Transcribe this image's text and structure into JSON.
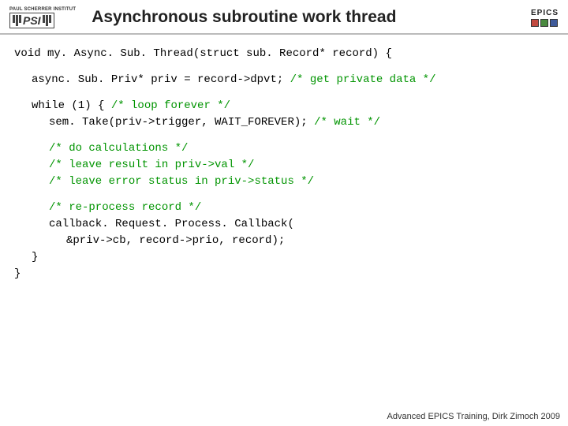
{
  "header": {
    "psi_top": "PAUL SCHERRER INSTITUT",
    "psi_text": "PSI",
    "title": "Asynchronous subroutine work thread",
    "epics_label": "EPICS"
  },
  "code": {
    "l01a": "void my. Async. Sub. Thread(struct sub. Record* record) {",
    "l02a": "async. Sub. Priv* priv = record->dpvt; ",
    "l02c": "/* get private data */",
    "l03a": "while (1) { ",
    "l03c": "/* loop forever */",
    "l04a": "sem. Take(priv->trigger, WAIT_FOREVER); ",
    "l04c": "/* wait */",
    "l05c": "/* do calculations */",
    "l06c": "/* leave result in priv->val */",
    "l07c": "/* leave error status in priv->status */",
    "l08c": "/* re-process record */",
    "l09a": "callback. Request. Process. Callback(",
    "l10a": "&priv->cb, record->prio, record);",
    "l11a": "}",
    "l12a": "}"
  },
  "footer": "Advanced EPICS Training, Dirk Zimoch 2009"
}
